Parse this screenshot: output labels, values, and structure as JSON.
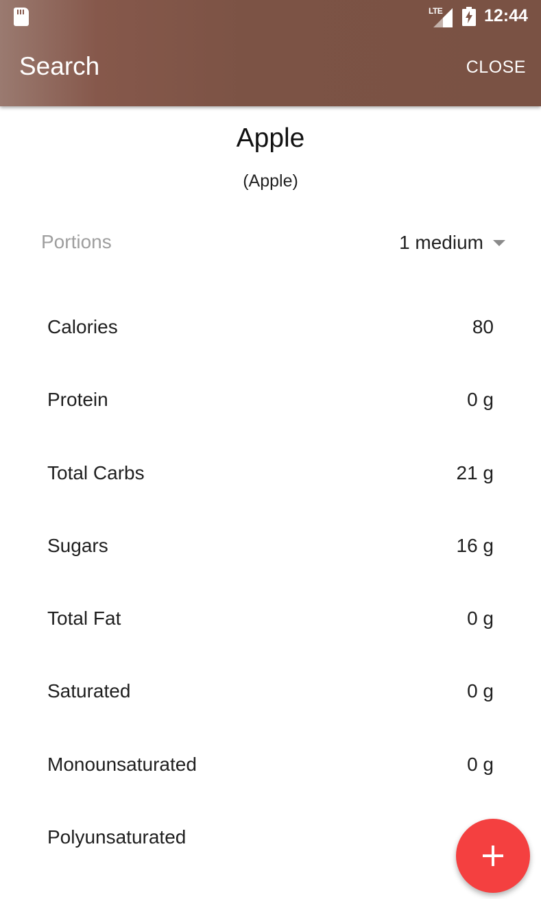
{
  "status_bar": {
    "network": "LTE",
    "time": "12:44"
  },
  "app_bar": {
    "title": "Search",
    "close_label": "CLOSE"
  },
  "food": {
    "name": "Apple",
    "subtitle": "(Apple)"
  },
  "portions": {
    "label": "Portions",
    "selected": "1 medium"
  },
  "nutrients": [
    {
      "label": "Calories",
      "value": "80"
    },
    {
      "label": "Protein",
      "value": "0 g"
    },
    {
      "label": "Total Carbs",
      "value": "21 g"
    },
    {
      "label": "Sugars",
      "value": "16 g"
    },
    {
      "label": "Total Fat",
      "value": "0 g"
    },
    {
      "label": "Saturated",
      "value": "0 g"
    },
    {
      "label": "Monounsaturated",
      "value": "0 g"
    },
    {
      "label": "Polyunsaturated",
      "value": ""
    }
  ],
  "colors": {
    "app_bar": "#7c5345",
    "fab": "#f44040"
  },
  "icons": {
    "sd_card": "sd-card-icon",
    "signal": "lte-signal-icon",
    "battery": "battery-charging-icon",
    "dropdown": "caret-down-icon",
    "fab": "plus-icon"
  }
}
